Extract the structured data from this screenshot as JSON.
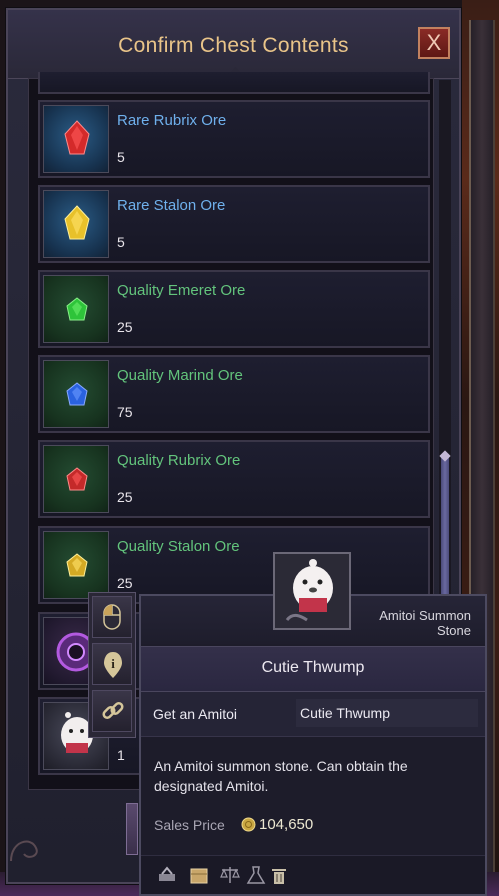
{
  "window": {
    "title": "Confirm Chest Contents",
    "close_label": "X"
  },
  "items": [
    {
      "name": "Rare Rubrix Ore",
      "qty": "5",
      "grade": "rare",
      "icon": "red-gem-icon",
      "color": "#d42a2a"
    },
    {
      "name": "Rare Stalon Ore",
      "qty": "5",
      "grade": "rare",
      "icon": "yellow-gem-icon",
      "color": "#e8c12a"
    },
    {
      "name": "Quality Emeret Ore",
      "qty": "25",
      "grade": "quality",
      "icon": "green-gem-icon",
      "color": "#2ec43a"
    },
    {
      "name": "Quality Marind Ore",
      "qty": "75",
      "grade": "quality",
      "icon": "blue-gem-icon",
      "color": "#2a62e0"
    },
    {
      "name": "Quality Rubrix Ore",
      "qty": "25",
      "grade": "quality",
      "icon": "red-gem-icon",
      "color": "#c42a2a"
    },
    {
      "name": "Quality Stalon Ore",
      "qty": "25",
      "grade": "quality",
      "icon": "yellow-gem-icon",
      "color": "#d4aa24"
    },
    {
      "name": "",
      "qty": "",
      "grade": "purple",
      "icon": "purple-orb-icon",
      "color": "#8a3ab8"
    },
    {
      "name": "",
      "qty": "1",
      "grade": "plain",
      "icon": "amitoi-stone-icon",
      "color": "#f0ecec"
    }
  ],
  "context_menu": [
    {
      "icon": "mouse-icon"
    },
    {
      "icon": "info-icon"
    },
    {
      "icon": "link-icon"
    }
  ],
  "tooltip": {
    "type": "Amitoi Summon Stone",
    "name": "Cutie Thwump",
    "get_label": "Get an Amitoi",
    "get_value": "Cutie Thwump",
    "description": "An Amitoi summon stone. Can obtain the designated Amitoi.",
    "price_label": "Sales Price",
    "price_value": "104,650",
    "bottom_icons": [
      "repair-icon",
      "box-icon",
      "scales-icon",
      "flask-icon",
      "trash-icon"
    ]
  },
  "colors": {
    "title": "#e9c489",
    "rare": "#6fb0ec",
    "quality": "#63c47c"
  }
}
